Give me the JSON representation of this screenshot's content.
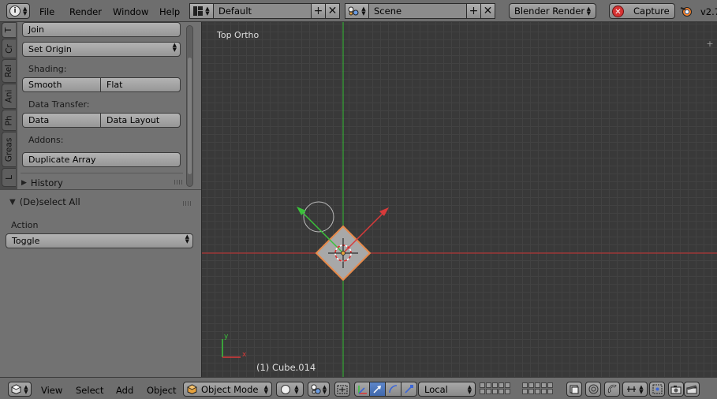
{
  "top_header": {
    "info_icon": "i",
    "menus": [
      "File",
      "Render",
      "Window",
      "Help"
    ],
    "screen_layout": "Default",
    "scene": "Scene",
    "render_engine": "Blender Render",
    "capture_label": "Capture",
    "version": "v2.7"
  },
  "tabs": [
    "T",
    "Cr",
    "Rel",
    "Ani",
    "Ph",
    "Greas",
    "L"
  ],
  "tool_shelf": {
    "join_label": "Join",
    "set_origin_label": "Set Origin",
    "shading_label": "Shading:",
    "smooth_label": "Smooth",
    "flat_label": "Flat",
    "data_transfer_label": "Data Transfer:",
    "data_label": "Data",
    "data_layout_label": "Data Layout",
    "addons_label": "Addons:",
    "duplicate_array_label": "Duplicate Array",
    "history_label": "History"
  },
  "operator_panel": {
    "title": "(De)select All",
    "action_label": "Action",
    "action_value": "Toggle"
  },
  "viewport": {
    "view_name": "Top Ortho",
    "object_info": "(1) Cube.014",
    "axis_x": "x",
    "axis_y": "y",
    "colors": {
      "x_axis": "#cc3333",
      "y_axis": "#33bb33",
      "selected_outline": "#e88a4a",
      "object_fill": "#a8a8a8"
    }
  },
  "bottom_header": {
    "menus": [
      "View",
      "Select",
      "Add",
      "Object"
    ],
    "mode": "Object Mode",
    "orientation": "Local"
  }
}
